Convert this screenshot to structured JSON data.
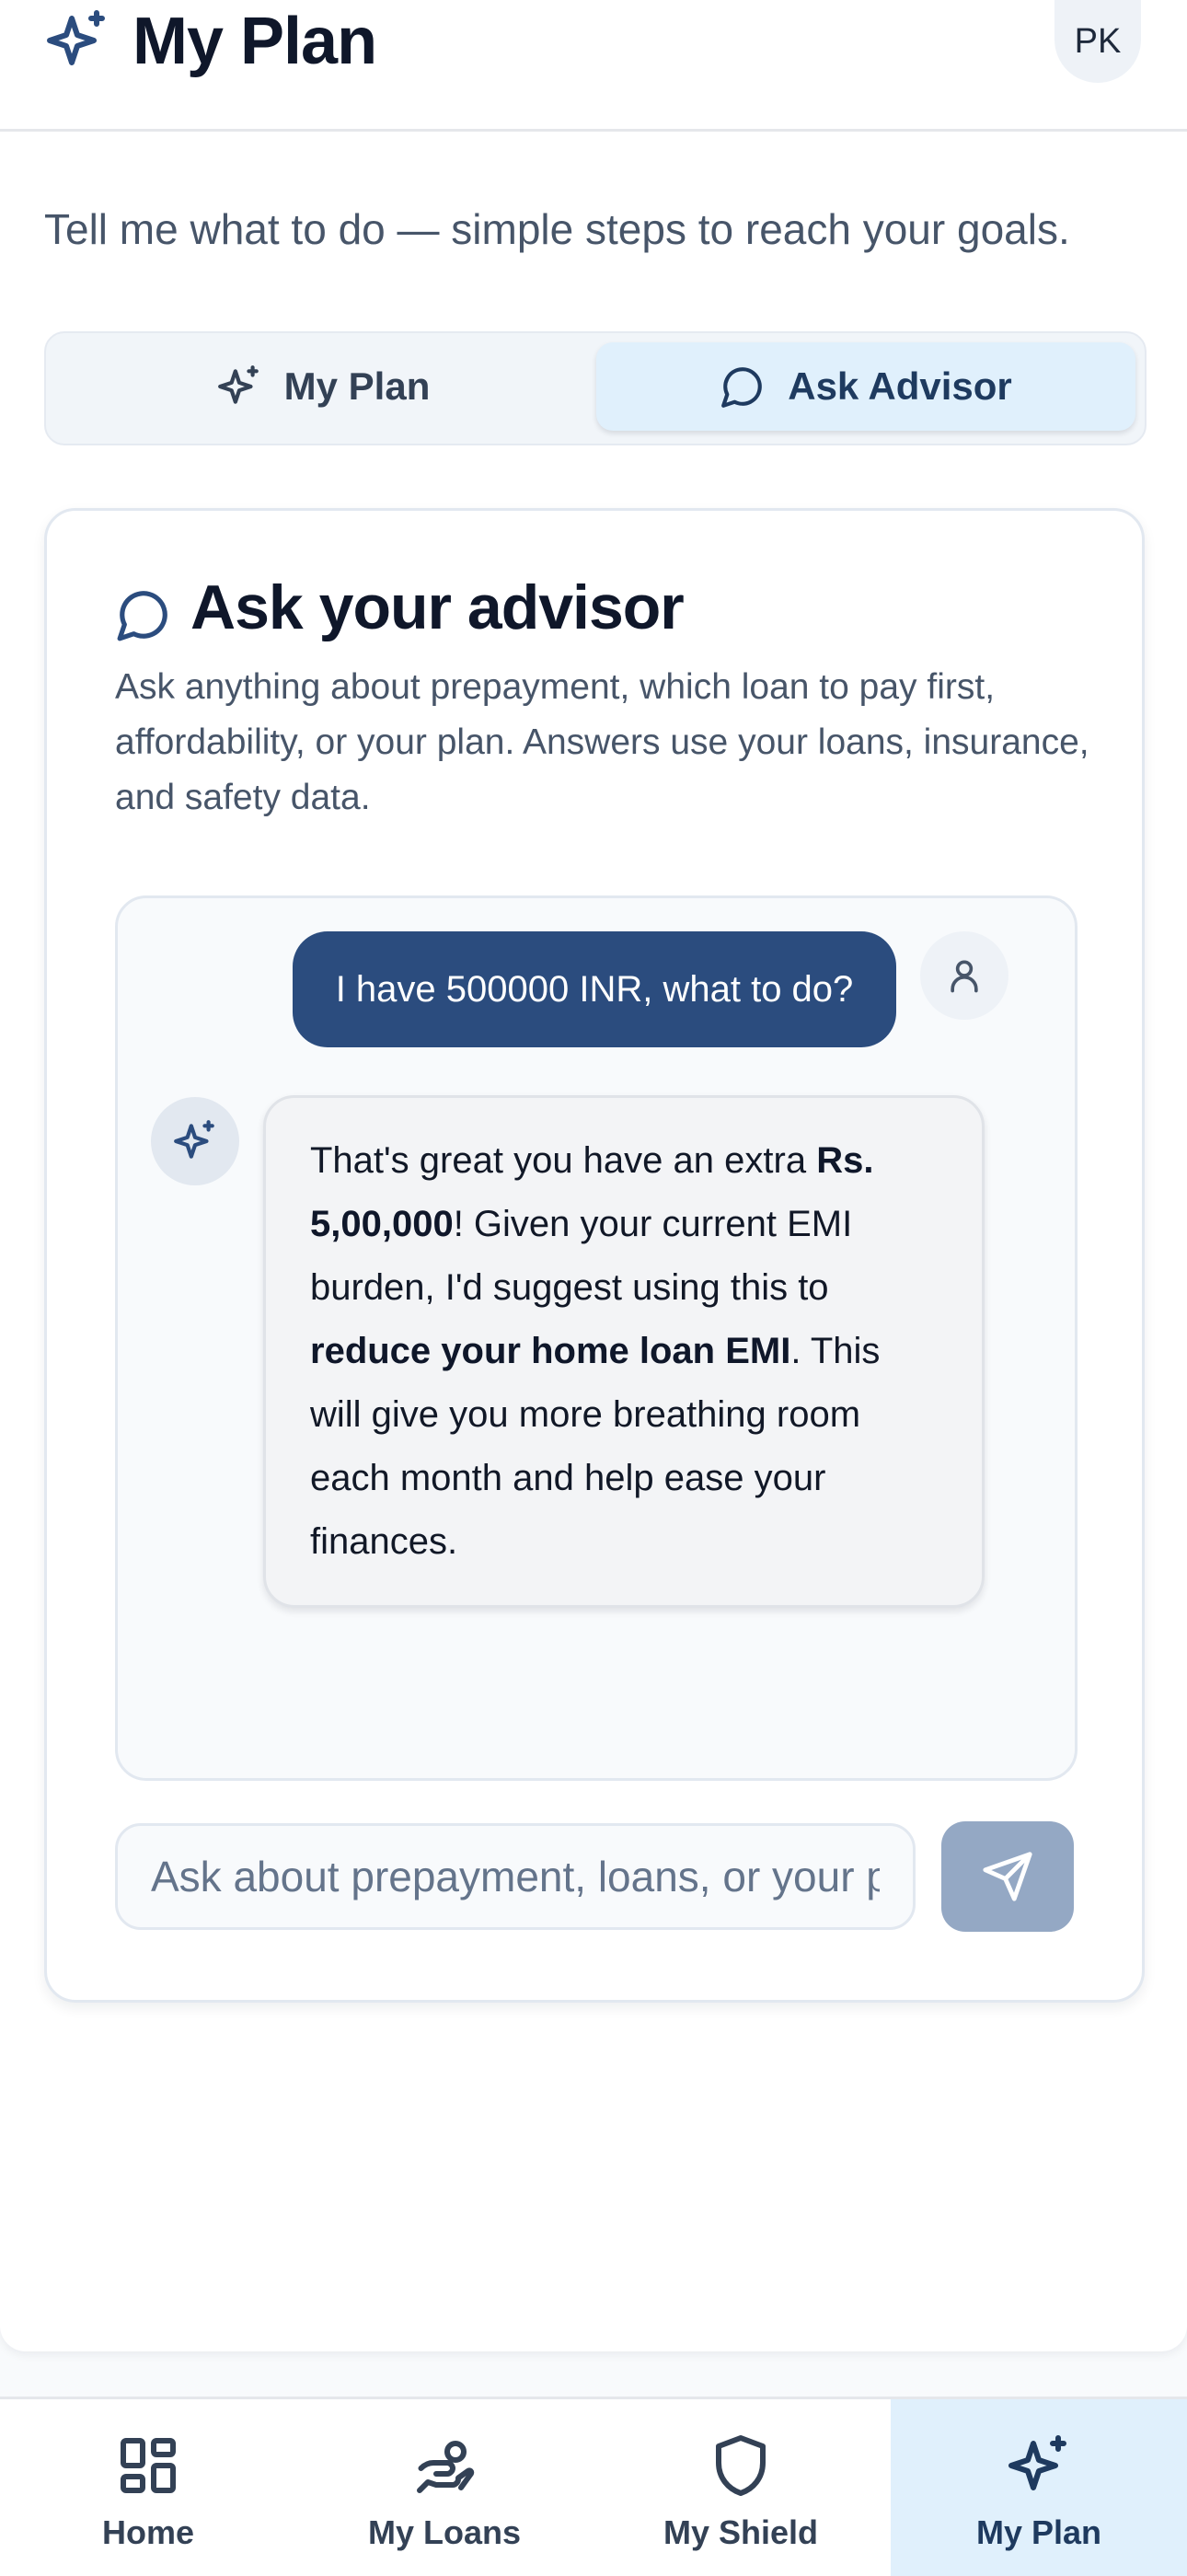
{
  "header": {
    "title": "My Plan",
    "avatar_initials": "PK",
    "icon": "sparkles-icon"
  },
  "subtitle": "Tell me what to do — simple steps to reach your goals.",
  "tabs": [
    {
      "label": "My Plan",
      "icon": "sparkles-icon",
      "active": false
    },
    {
      "label": "Ask Advisor",
      "icon": "chat-bubble-icon",
      "active": true
    }
  ],
  "advisor": {
    "title": "Ask your advisor",
    "description": "Ask anything about prepayment, which loan to pay first, affordability, or your plan. Answers use your loans, insurance, and safety data.",
    "messages": {
      "user": "I have 500000 INR, what to do?",
      "bot": {
        "t1": "That's great you have an extra ",
        "b1": "Rs. 5,00,000",
        "t2": "! Given your current EMI burden, I'd suggest using this to ",
        "b2": "reduce your home loan EMI",
        "t3": ". This will give you more breathing room each month and help ease your finances."
      }
    },
    "input_placeholder": "Ask about prepayment, loans, or your plan",
    "send_icon": "send-icon"
  },
  "bottom_nav": [
    {
      "label": "Home",
      "icon": "grid-icon",
      "active": false
    },
    {
      "label": "My Loans",
      "icon": "hand-coins-icon",
      "active": false
    },
    {
      "label": "My Shield",
      "icon": "shield-icon",
      "active": false
    },
    {
      "label": "My Plan",
      "icon": "sparkles-icon",
      "active": true
    }
  ],
  "colors": {
    "primary": "#2b4c7e",
    "active_tab_bg": "#e0f0fc",
    "send_button": "#94a8c4"
  }
}
